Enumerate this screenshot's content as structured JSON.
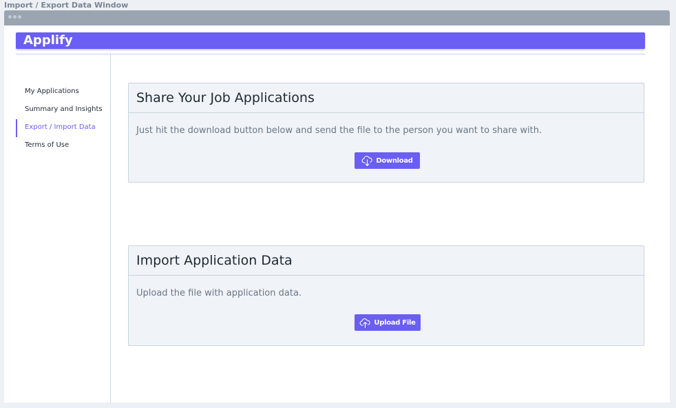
{
  "window": {
    "caption": "Import / Export Data Window"
  },
  "app": {
    "title": "Applify",
    "accent_color": "#6a5ef3"
  },
  "sidebar": {
    "items": [
      {
        "label": "My Applications",
        "active": false
      },
      {
        "label": "Summary and Insights",
        "active": false
      },
      {
        "label": "Export / Import Data",
        "active": true
      },
      {
        "label": "Terms of Use",
        "active": false
      }
    ]
  },
  "share": {
    "title": "Share Your Job Applications",
    "description": "Just hit the download button below and send the file to the person you want to share with.",
    "button_label": "Download",
    "button_icon": "cloud-download-icon"
  },
  "import": {
    "title": "Import Application Data",
    "description": "Upload the file with application data.",
    "button_label": "Upload File",
    "button_icon": "cloud-upload-icon"
  }
}
